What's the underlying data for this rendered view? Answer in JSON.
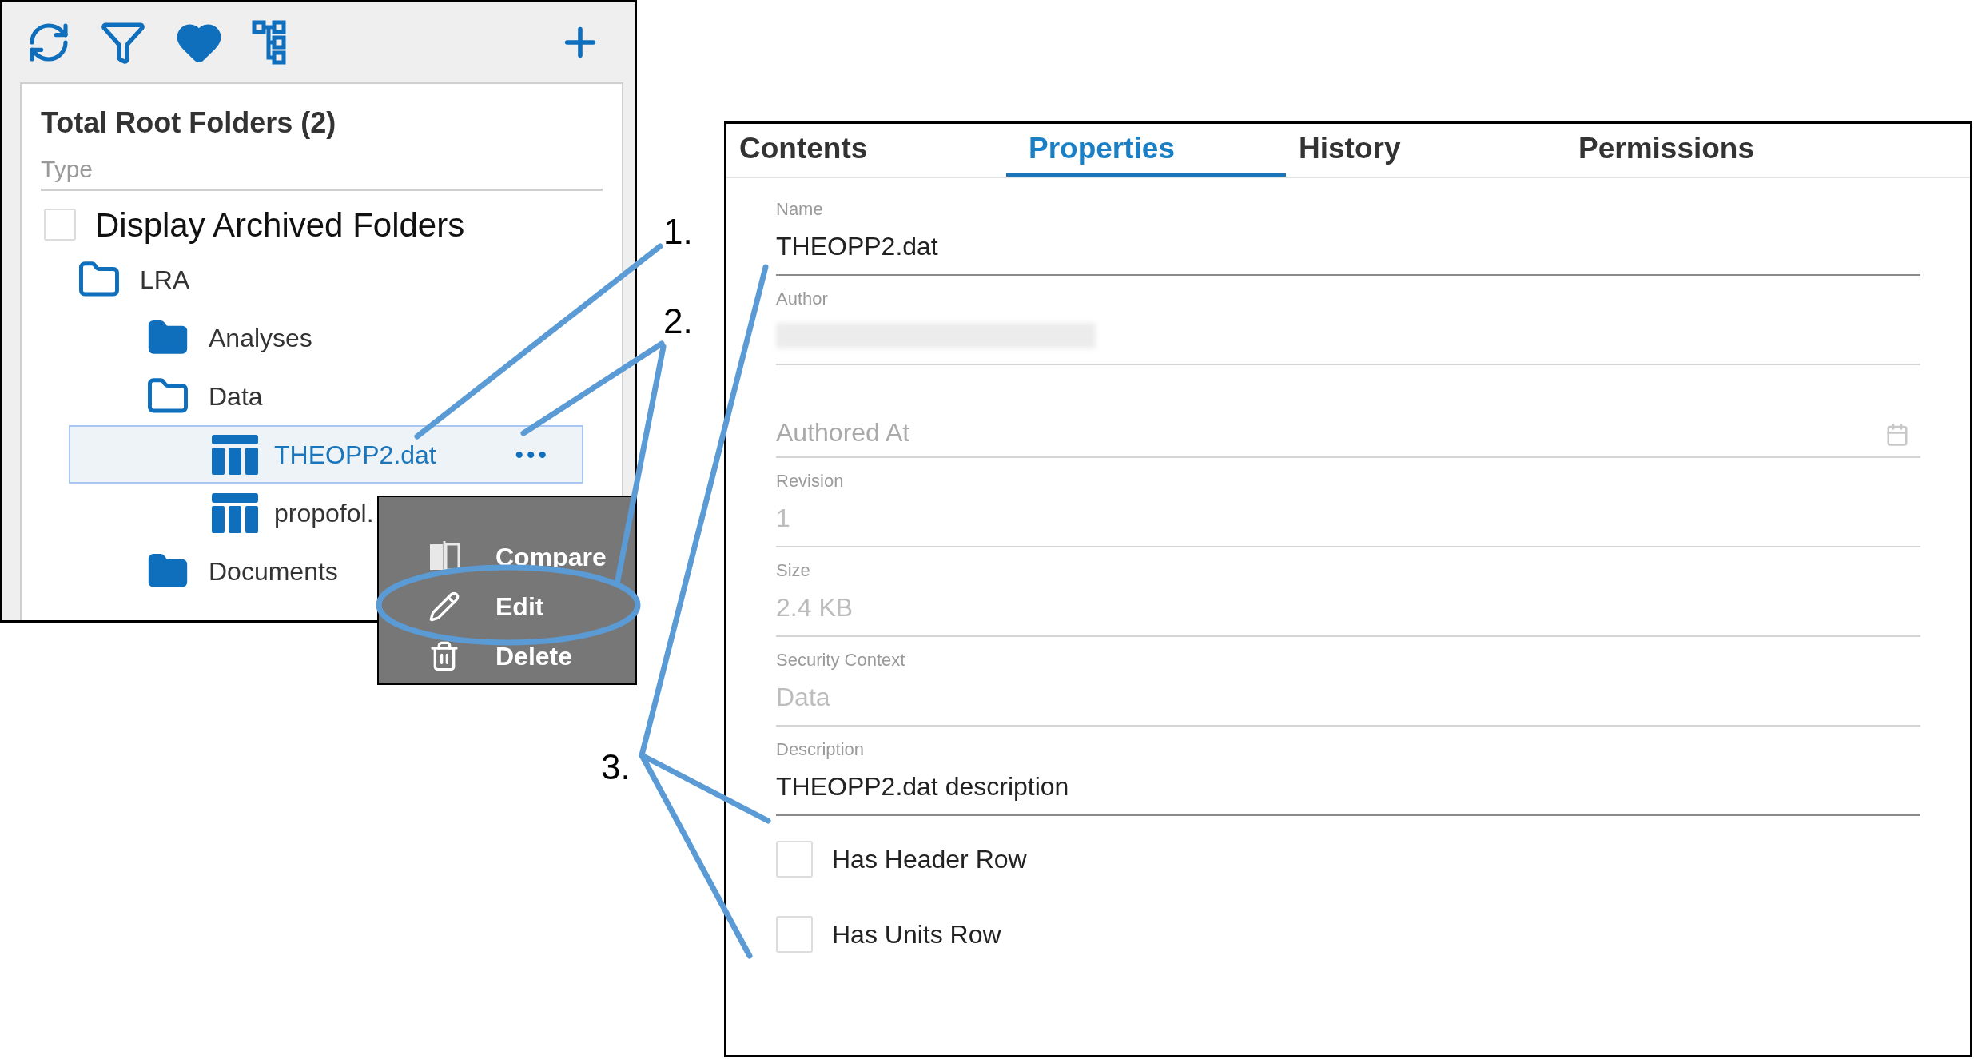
{
  "browser_panel": {
    "title": "Total Root Folders (2)",
    "type_placeholder": "Type",
    "archived_checkbox": {
      "label": "Display Archived Folders",
      "checked": false
    },
    "tree": [
      {
        "kind": "folder",
        "label": "LRA",
        "expanded": true,
        "selected": false,
        "children": [
          {
            "kind": "folder",
            "label": "Analyses",
            "expanded": false,
            "selected": false
          },
          {
            "kind": "folder",
            "label": "Data",
            "expanded": true,
            "selected": false,
            "children": [
              {
                "kind": "file",
                "label": "THEOPP2.dat",
                "selected": true,
                "more": "•••"
              },
              {
                "kind": "file",
                "label": "propofol.",
                "selected": false
              }
            ]
          },
          {
            "kind": "folder",
            "label": "Documents",
            "expanded": false,
            "selected": false
          }
        ]
      }
    ]
  },
  "context_menu": [
    {
      "kind": "compare",
      "label": "Compare",
      "circled": false
    },
    {
      "kind": "edit",
      "label": "Edit",
      "circled": true
    },
    {
      "kind": "delete",
      "label": "Delete",
      "circled": false
    }
  ],
  "properties_panel": {
    "tabs": [
      {
        "label": "Contents",
        "selected": false
      },
      {
        "label": "Properties",
        "selected": true
      },
      {
        "label": "History",
        "selected": false
      },
      {
        "label": "Permissions",
        "selected": false
      }
    ],
    "fields": [
      {
        "kind": "text",
        "label": "Name",
        "value": "THEOPP2.dat",
        "disabled": false
      },
      {
        "kind": "redacted",
        "label": "Author",
        "disabled": true
      },
      {
        "kind": "date",
        "placeholder": "Authored At",
        "disabled": true
      },
      {
        "kind": "text",
        "label": "Revision",
        "value": "1",
        "disabled": true
      },
      {
        "kind": "text",
        "label": "Size",
        "value": "2.4 KB",
        "disabled": true
      },
      {
        "kind": "text",
        "label": "Security Context",
        "value": "Data",
        "disabled": true
      },
      {
        "kind": "text",
        "label": "Description",
        "value": "THEOPP2.dat description",
        "disabled": false
      }
    ],
    "checkboxes": [
      {
        "label": "Has Header Row",
        "checked": false
      },
      {
        "label": "Has Units Row",
        "checked": false
      }
    ]
  },
  "callouts": [
    {
      "number": "1."
    },
    {
      "number": "2."
    },
    {
      "number": "3."
    }
  ]
}
